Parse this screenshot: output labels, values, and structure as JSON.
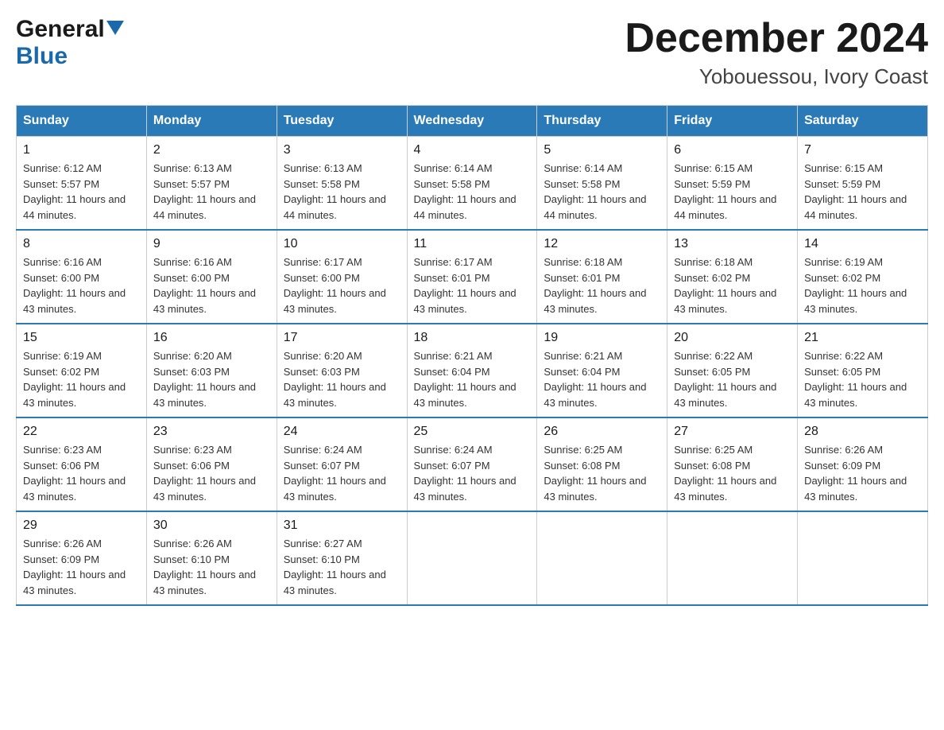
{
  "header": {
    "logo_general": "General",
    "logo_blue": "Blue",
    "month_title": "December 2024",
    "location": "Yobouessou, Ivory Coast"
  },
  "days_of_week": [
    "Sunday",
    "Monday",
    "Tuesday",
    "Wednesday",
    "Thursday",
    "Friday",
    "Saturday"
  ],
  "weeks": [
    [
      {
        "day": "1",
        "sunrise": "6:12 AM",
        "sunset": "5:57 PM",
        "daylight": "11 hours and 44 minutes."
      },
      {
        "day": "2",
        "sunrise": "6:13 AM",
        "sunset": "5:57 PM",
        "daylight": "11 hours and 44 minutes."
      },
      {
        "day": "3",
        "sunrise": "6:13 AM",
        "sunset": "5:58 PM",
        "daylight": "11 hours and 44 minutes."
      },
      {
        "day": "4",
        "sunrise": "6:14 AM",
        "sunset": "5:58 PM",
        "daylight": "11 hours and 44 minutes."
      },
      {
        "day": "5",
        "sunrise": "6:14 AM",
        "sunset": "5:58 PM",
        "daylight": "11 hours and 44 minutes."
      },
      {
        "day": "6",
        "sunrise": "6:15 AM",
        "sunset": "5:59 PM",
        "daylight": "11 hours and 44 minutes."
      },
      {
        "day": "7",
        "sunrise": "6:15 AM",
        "sunset": "5:59 PM",
        "daylight": "11 hours and 44 minutes."
      }
    ],
    [
      {
        "day": "8",
        "sunrise": "6:16 AM",
        "sunset": "6:00 PM",
        "daylight": "11 hours and 43 minutes."
      },
      {
        "day": "9",
        "sunrise": "6:16 AM",
        "sunset": "6:00 PM",
        "daylight": "11 hours and 43 minutes."
      },
      {
        "day": "10",
        "sunrise": "6:17 AM",
        "sunset": "6:00 PM",
        "daylight": "11 hours and 43 minutes."
      },
      {
        "day": "11",
        "sunrise": "6:17 AM",
        "sunset": "6:01 PM",
        "daylight": "11 hours and 43 minutes."
      },
      {
        "day": "12",
        "sunrise": "6:18 AM",
        "sunset": "6:01 PM",
        "daylight": "11 hours and 43 minutes."
      },
      {
        "day": "13",
        "sunrise": "6:18 AM",
        "sunset": "6:02 PM",
        "daylight": "11 hours and 43 minutes."
      },
      {
        "day": "14",
        "sunrise": "6:19 AM",
        "sunset": "6:02 PM",
        "daylight": "11 hours and 43 minutes."
      }
    ],
    [
      {
        "day": "15",
        "sunrise": "6:19 AM",
        "sunset": "6:02 PM",
        "daylight": "11 hours and 43 minutes."
      },
      {
        "day": "16",
        "sunrise": "6:20 AM",
        "sunset": "6:03 PM",
        "daylight": "11 hours and 43 minutes."
      },
      {
        "day": "17",
        "sunrise": "6:20 AM",
        "sunset": "6:03 PM",
        "daylight": "11 hours and 43 minutes."
      },
      {
        "day": "18",
        "sunrise": "6:21 AM",
        "sunset": "6:04 PM",
        "daylight": "11 hours and 43 minutes."
      },
      {
        "day": "19",
        "sunrise": "6:21 AM",
        "sunset": "6:04 PM",
        "daylight": "11 hours and 43 minutes."
      },
      {
        "day": "20",
        "sunrise": "6:22 AM",
        "sunset": "6:05 PM",
        "daylight": "11 hours and 43 minutes."
      },
      {
        "day": "21",
        "sunrise": "6:22 AM",
        "sunset": "6:05 PM",
        "daylight": "11 hours and 43 minutes."
      }
    ],
    [
      {
        "day": "22",
        "sunrise": "6:23 AM",
        "sunset": "6:06 PM",
        "daylight": "11 hours and 43 minutes."
      },
      {
        "day": "23",
        "sunrise": "6:23 AM",
        "sunset": "6:06 PM",
        "daylight": "11 hours and 43 minutes."
      },
      {
        "day": "24",
        "sunrise": "6:24 AM",
        "sunset": "6:07 PM",
        "daylight": "11 hours and 43 minutes."
      },
      {
        "day": "25",
        "sunrise": "6:24 AM",
        "sunset": "6:07 PM",
        "daylight": "11 hours and 43 minutes."
      },
      {
        "day": "26",
        "sunrise": "6:25 AM",
        "sunset": "6:08 PM",
        "daylight": "11 hours and 43 minutes."
      },
      {
        "day": "27",
        "sunrise": "6:25 AM",
        "sunset": "6:08 PM",
        "daylight": "11 hours and 43 minutes."
      },
      {
        "day": "28",
        "sunrise": "6:26 AM",
        "sunset": "6:09 PM",
        "daylight": "11 hours and 43 minutes."
      }
    ],
    [
      {
        "day": "29",
        "sunrise": "6:26 AM",
        "sunset": "6:09 PM",
        "daylight": "11 hours and 43 minutes."
      },
      {
        "day": "30",
        "sunrise": "6:26 AM",
        "sunset": "6:10 PM",
        "daylight": "11 hours and 43 minutes."
      },
      {
        "day": "31",
        "sunrise": "6:27 AM",
        "sunset": "6:10 PM",
        "daylight": "11 hours and 43 minutes."
      },
      null,
      null,
      null,
      null
    ]
  ],
  "labels": {
    "sunrise_prefix": "Sunrise: ",
    "sunset_prefix": "Sunset: ",
    "daylight_prefix": "Daylight: "
  }
}
